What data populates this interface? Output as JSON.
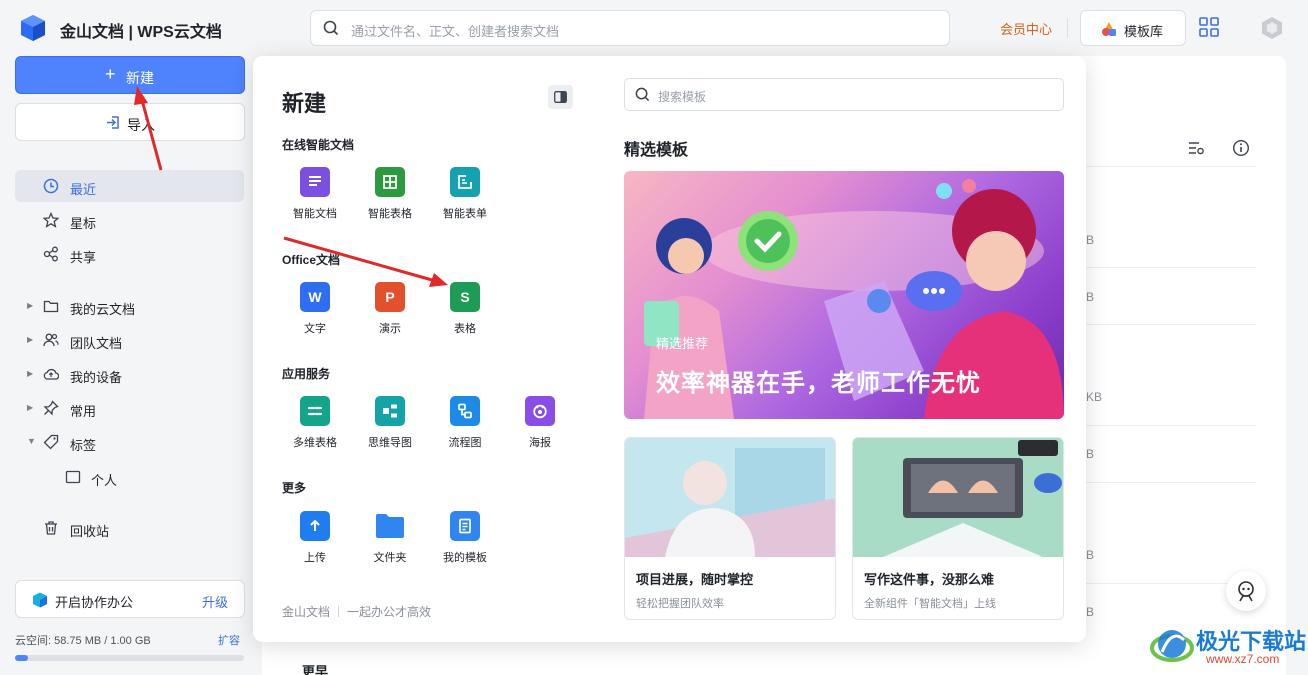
{
  "app": {
    "title": "金山文档 | WPS云文档"
  },
  "topbar": {
    "search_placeholder": "通过文件名、正文、创建者搜索文档",
    "vip_label": "会员中心",
    "template_label": "模板库"
  },
  "sidebar": {
    "new_label": "新建",
    "import_label": "导入",
    "items": [
      {
        "label": "最近",
        "icon": "clock-icon"
      },
      {
        "label": "星标",
        "icon": "star-icon"
      },
      {
        "label": "共享",
        "icon": "share-icon"
      },
      {
        "label": "我的云文档",
        "icon": "folder-icon"
      },
      {
        "label": "团队文档",
        "icon": "team-icon"
      },
      {
        "label": "我的设备",
        "icon": "cloud-icon"
      },
      {
        "label": "常用",
        "icon": "pin-icon"
      },
      {
        "label": "标签",
        "icon": "tag-icon"
      },
      {
        "label": "个人",
        "icon": "tag-folder-icon"
      },
      {
        "label": "回收站",
        "icon": "trash-icon"
      }
    ],
    "collab_label": "开启协作办公",
    "upgrade_label": "升级",
    "storage_text": "云空间: 58.75 MB / 1.00 GB",
    "expand_label": "扩容",
    "storage_fraction": 0.057
  },
  "popup": {
    "title": "新建",
    "groups": [
      {
        "title": "在线智能文档",
        "items": [
          {
            "label": "智能文档",
            "icon": "smart-doc-icon",
            "color": "#7b4fe0"
          },
          {
            "label": "智能表格",
            "icon": "smart-sheet-icon",
            "color": "#2e9a3f"
          },
          {
            "label": "智能表单",
            "icon": "smart-form-icon",
            "color": "#16a1b0"
          }
        ]
      },
      {
        "title": "Office文档",
        "items": [
          {
            "label": "文字",
            "icon": "word-icon",
            "color": "#2f6ef0",
            "glyph": "W"
          },
          {
            "label": "演示",
            "icon": "ppt-icon",
            "color": "#e2512c",
            "glyph": "P"
          },
          {
            "label": "表格",
            "icon": "excel-icon",
            "color": "#1e9b55",
            "glyph": "S"
          }
        ]
      },
      {
        "title": "应用服务",
        "items": [
          {
            "label": "多维表格",
            "icon": "multi-table-icon",
            "color": "#13a58a"
          },
          {
            "label": "思维导图",
            "icon": "mindmap-icon",
            "color": "#14a3a6"
          },
          {
            "label": "流程图",
            "icon": "flowchart-icon",
            "color": "#1d8ae8"
          },
          {
            "label": "海报",
            "icon": "poster-icon",
            "color": "#8a4ee8"
          }
        ]
      },
      {
        "title": "更多",
        "items": [
          {
            "label": "上传",
            "icon": "upload-icon",
            "color": "#1f7df0"
          },
          {
            "label": "文件夹",
            "icon": "folder-icon",
            "color": "#2f86f0"
          },
          {
            "label": "我的模板",
            "icon": "my-template-icon",
            "color": "#2f86f0"
          }
        ]
      }
    ],
    "footer_brand": "金山文档",
    "footer_slogan": "一起办公才高效",
    "template_search_placeholder": "搜索模板",
    "featured_title": "精选模板",
    "banner": {
      "tag": "精选推荐",
      "headline": "效率神器在手，老师工作无忧"
    },
    "cards": [
      {
        "title": "项目进展，随时掌控",
        "subtitle": "轻松把握团队效率"
      },
      {
        "title": "写作这件事，没那么难",
        "subtitle": "全新组件「智能文档」上线"
      }
    ]
  },
  "background": {
    "sizes": [
      "B",
      "B",
      "KB",
      "B",
      "B",
      "B"
    ],
    "section_label": "更早"
  },
  "watermark": {
    "brand": "极光下载站",
    "url": "www.xz7.com"
  }
}
